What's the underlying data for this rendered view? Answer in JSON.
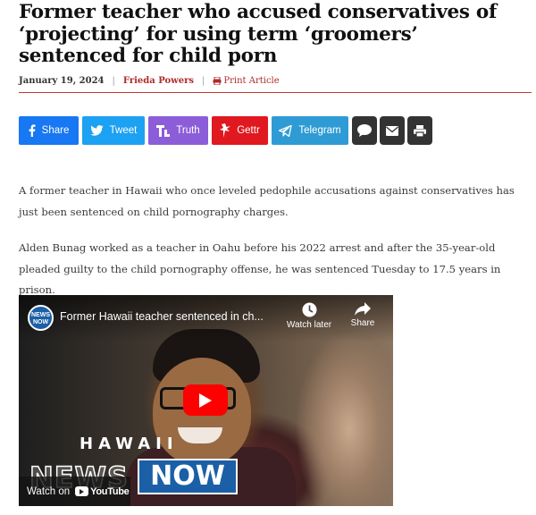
{
  "article": {
    "headline": "Former teacher who accused conservatives of ‘projecting’ for using term ‘groomers’ sentenced for child porn",
    "date": "January 19, 2024",
    "separator": "|",
    "author": "Frieda Powers",
    "print_label": "Print Article",
    "paragraphs": [
      "A former teacher in Hawaii who once leveled pedophile accusations against conservatives has just been sentenced on child pornography charges.",
      "Alden Bunag worked as a teacher in Oahu before his 2022 arrest and after the 35-year-old pleaded guilty to the child pornography offense, he was sentenced Tuesday to 17.5 years in prison."
    ]
  },
  "share_bar": {
    "facebook": "Share",
    "twitter": "Tweet",
    "truth": "Truth",
    "gettr": "Gettr",
    "telegram": "Telegram"
  },
  "video": {
    "channel_logo_line1": "NEWS",
    "channel_logo_line2": "NOW",
    "title": "Former Hawaii teacher sentenced in ch...",
    "watch_later": "Watch later",
    "share": "Share",
    "overlay_hawaii": "HAWAII",
    "overlay_news": "NEWS",
    "overlay_now": "NOW",
    "watch_on": "Watch on",
    "youtube": "YouTube"
  },
  "colors": {
    "accent_red": "#c0392b",
    "facebook": "#1877f2",
    "twitter": "#1da1f2",
    "truth": "#8c5dd9",
    "gettr": "#e0181f",
    "telegram": "#2f9bd4",
    "dark_button": "#333333"
  }
}
